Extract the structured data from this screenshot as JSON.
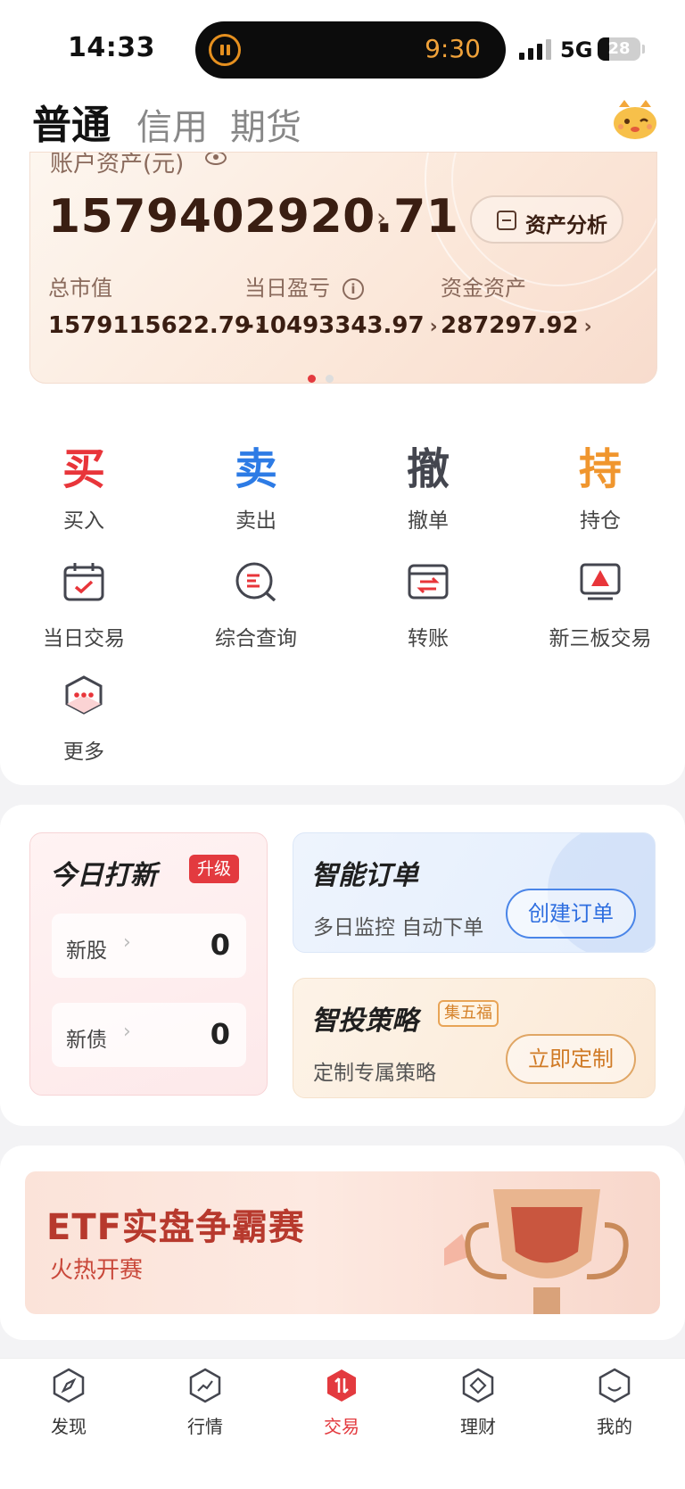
{
  "status_bar": {
    "time": "14:33",
    "island_time": "9:30",
    "network": "5G",
    "battery": "28",
    "battery_level_percent": 28
  },
  "top_tabs": {
    "items": [
      "普通",
      "信用",
      "期货"
    ],
    "active": "普通"
  },
  "asset_card": {
    "label": "账户资产(元)",
    "total": "1579402920.71",
    "analysis_button": "资产分析",
    "metrics": [
      {
        "label": "总市值",
        "value": "1579115622.79"
      },
      {
        "label": "当日盈亏",
        "value": "-10493343.97"
      },
      {
        "label": "资金资产",
        "value": "287297.92"
      }
    ],
    "pager": {
      "count": 2,
      "active_index": 0
    }
  },
  "quick_actions": [
    {
      "glyph": "买",
      "label": "买入",
      "color": "#e8353a"
    },
    {
      "glyph": "卖",
      "label": "卖出",
      "color": "#2d7be5"
    },
    {
      "glyph": "撤",
      "label": "撤单",
      "color": "#44464f"
    },
    {
      "glyph": "持",
      "label": "持仓",
      "color": "#f0962e"
    }
  ],
  "tools": [
    {
      "label": "当日交易",
      "icon": "calendar-check-icon"
    },
    {
      "label": "综合查询",
      "icon": "search-list-icon"
    },
    {
      "label": "转账",
      "icon": "transfer-card-icon"
    },
    {
      "label": "新三板交易",
      "icon": "board-screen-icon"
    },
    {
      "label": "更多",
      "icon": "more-hexagon-icon"
    }
  ],
  "ipo": {
    "title": "今日打新",
    "badge": "升级",
    "rows": [
      {
        "label": "新股",
        "value": "0"
      },
      {
        "label": "新债",
        "value": "0"
      }
    ]
  },
  "smart_order": {
    "title": "智能订单",
    "subtitle": "多日监控 自动下单",
    "button": "创建订单"
  },
  "strategy": {
    "title": "智投策略",
    "badge": "集五福",
    "subtitle": "定制专属策略",
    "button": "立即定制"
  },
  "banner": {
    "title": "ETF实盘争霸赛",
    "subtitle": "火热开赛"
  },
  "bottom_nav": {
    "items": [
      "发现",
      "行情",
      "交易",
      "理财",
      "我的"
    ],
    "active": "交易"
  },
  "colors": {
    "accent_red": "#e33a3f",
    "blue": "#2d7be5",
    "orange": "#f0962e",
    "asset_text": "#3a1e12"
  }
}
